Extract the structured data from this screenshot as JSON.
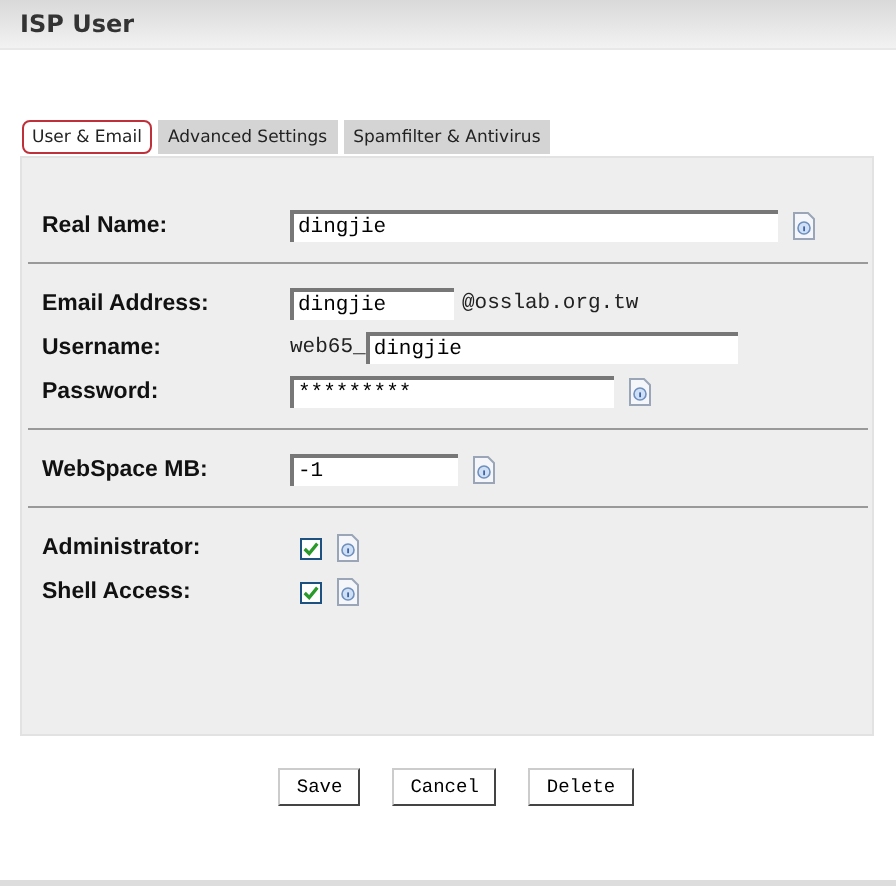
{
  "title": "ISP User",
  "tabs": [
    {
      "label": "User & Email",
      "selected": true
    },
    {
      "label": "Advanced Settings",
      "selected": false
    },
    {
      "label": "Spamfilter & Antivirus",
      "selected": false
    }
  ],
  "sections": [
    [
      {
        "kind": "text",
        "label": "Real Name:",
        "value": "dingjie"
      }
    ],
    [
      {
        "kind": "email",
        "label": "Email Address:",
        "value": "dingjie",
        "suffix": "@osslab.org.tw"
      },
      {
        "kind": "prefixed",
        "label": "Username:",
        "prefix": "web65_",
        "value": "dingjie"
      },
      {
        "kind": "password",
        "label": "Password:",
        "value": "*********"
      }
    ],
    [
      {
        "kind": "number",
        "label": "WebSpace MB:",
        "value": "-1"
      }
    ],
    [
      {
        "kind": "checkbox",
        "label": "Administrator:",
        "checked": true
      },
      {
        "kind": "checkbox",
        "label": "Shell Access:",
        "checked": true
      }
    ]
  ],
  "buttons": [
    "Save",
    "Cancel",
    "Delete"
  ]
}
